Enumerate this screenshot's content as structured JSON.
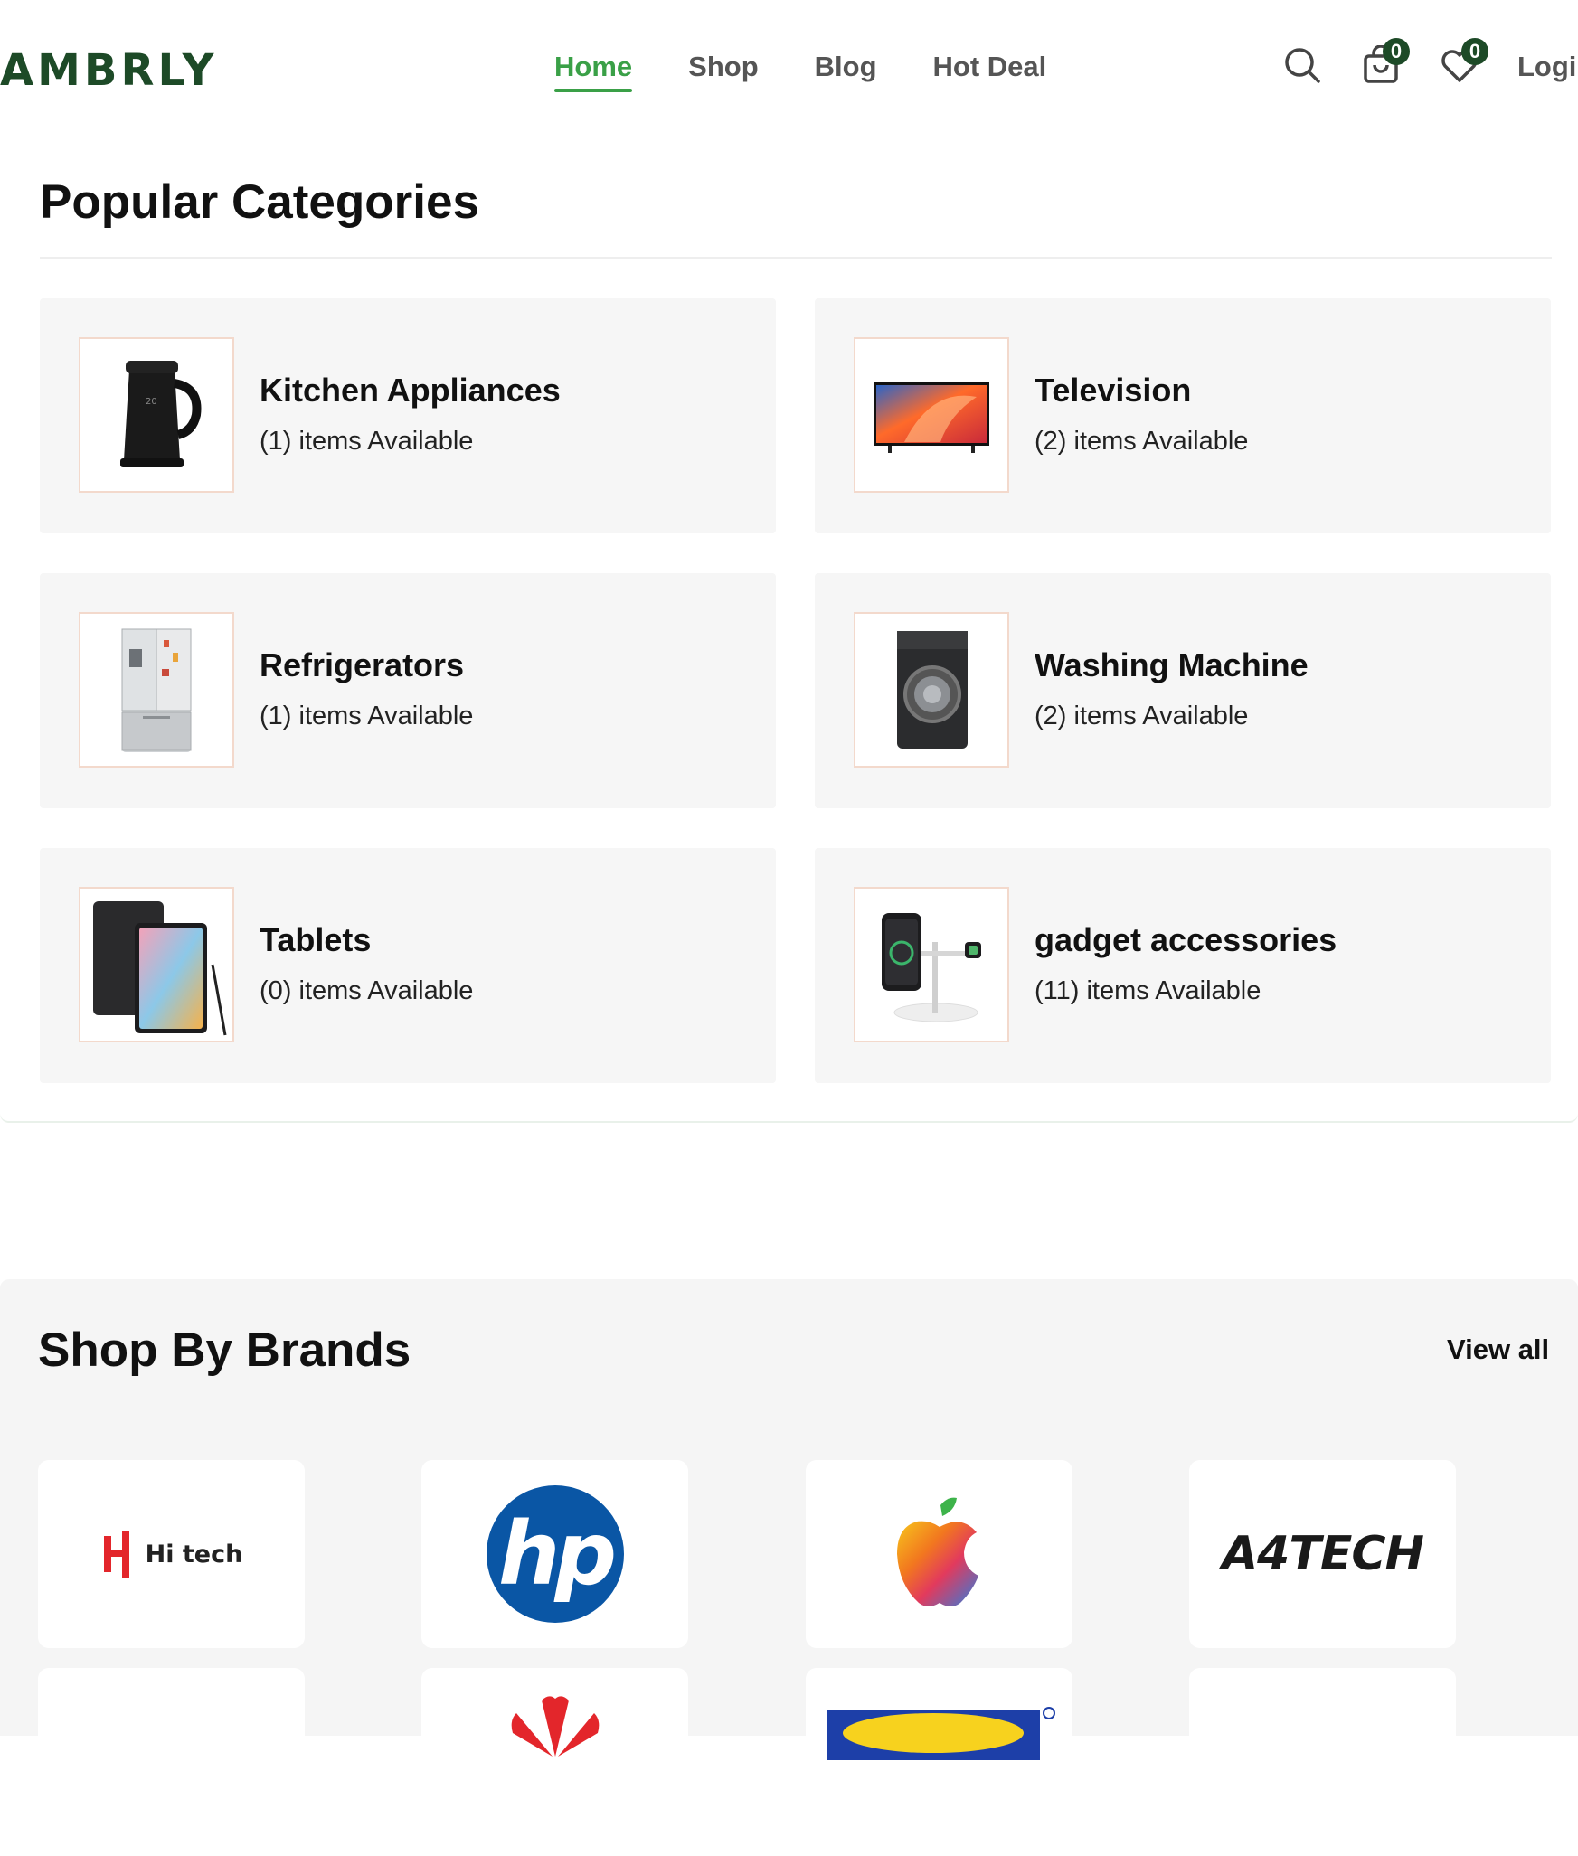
{
  "header": {
    "logo": "AMBRLY",
    "nav": [
      "Home",
      "Shop",
      "Blog",
      "Hot Deal"
    ],
    "active_nav": "Home",
    "cart_count": "0",
    "wishlist_count": "0",
    "login_label": "Login",
    "accent_color": "#3aa047",
    "brand_color": "#1d4a27"
  },
  "categories": {
    "title": "Popular Categories",
    "items": [
      {
        "name": "Kitchen Appliances",
        "count": "(1)",
        "suffix": " items Available",
        "icon": "kettle-image"
      },
      {
        "name": "Television",
        "count": "(2)",
        "suffix": " items Available",
        "icon": "television-image"
      },
      {
        "name": "Refrigerators",
        "count": "(1)",
        "suffix": " items Available",
        "icon": "refrigerator-image"
      },
      {
        "name": "Washing Machine",
        "count": "(2)",
        "suffix": " items Available",
        "icon": "washing-machine-image"
      },
      {
        "name": "Tablets",
        "count": "(0)",
        "suffix": " items Available",
        "icon": "tablet-image"
      },
      {
        "name": "gadget accessories",
        "count": "(11)",
        "suffix": " items Available",
        "icon": "charger-image"
      }
    ]
  },
  "brands": {
    "title": "Shop By Brands",
    "view_all": "View all",
    "logos": [
      {
        "name": "hitech-logo",
        "text": "Hi tech"
      },
      {
        "name": "hp-logo",
        "text": "hp"
      },
      {
        "name": "apple-logo",
        "text": ""
      },
      {
        "name": "a4tech-logo",
        "text": "A4TECH"
      },
      {
        "name": "brand-logo-5",
        "text": ""
      },
      {
        "name": "huawei-logo",
        "text": ""
      },
      {
        "name": "brand-logo-7",
        "text": ""
      },
      {
        "name": "brand-logo-8",
        "text": ""
      }
    ]
  }
}
